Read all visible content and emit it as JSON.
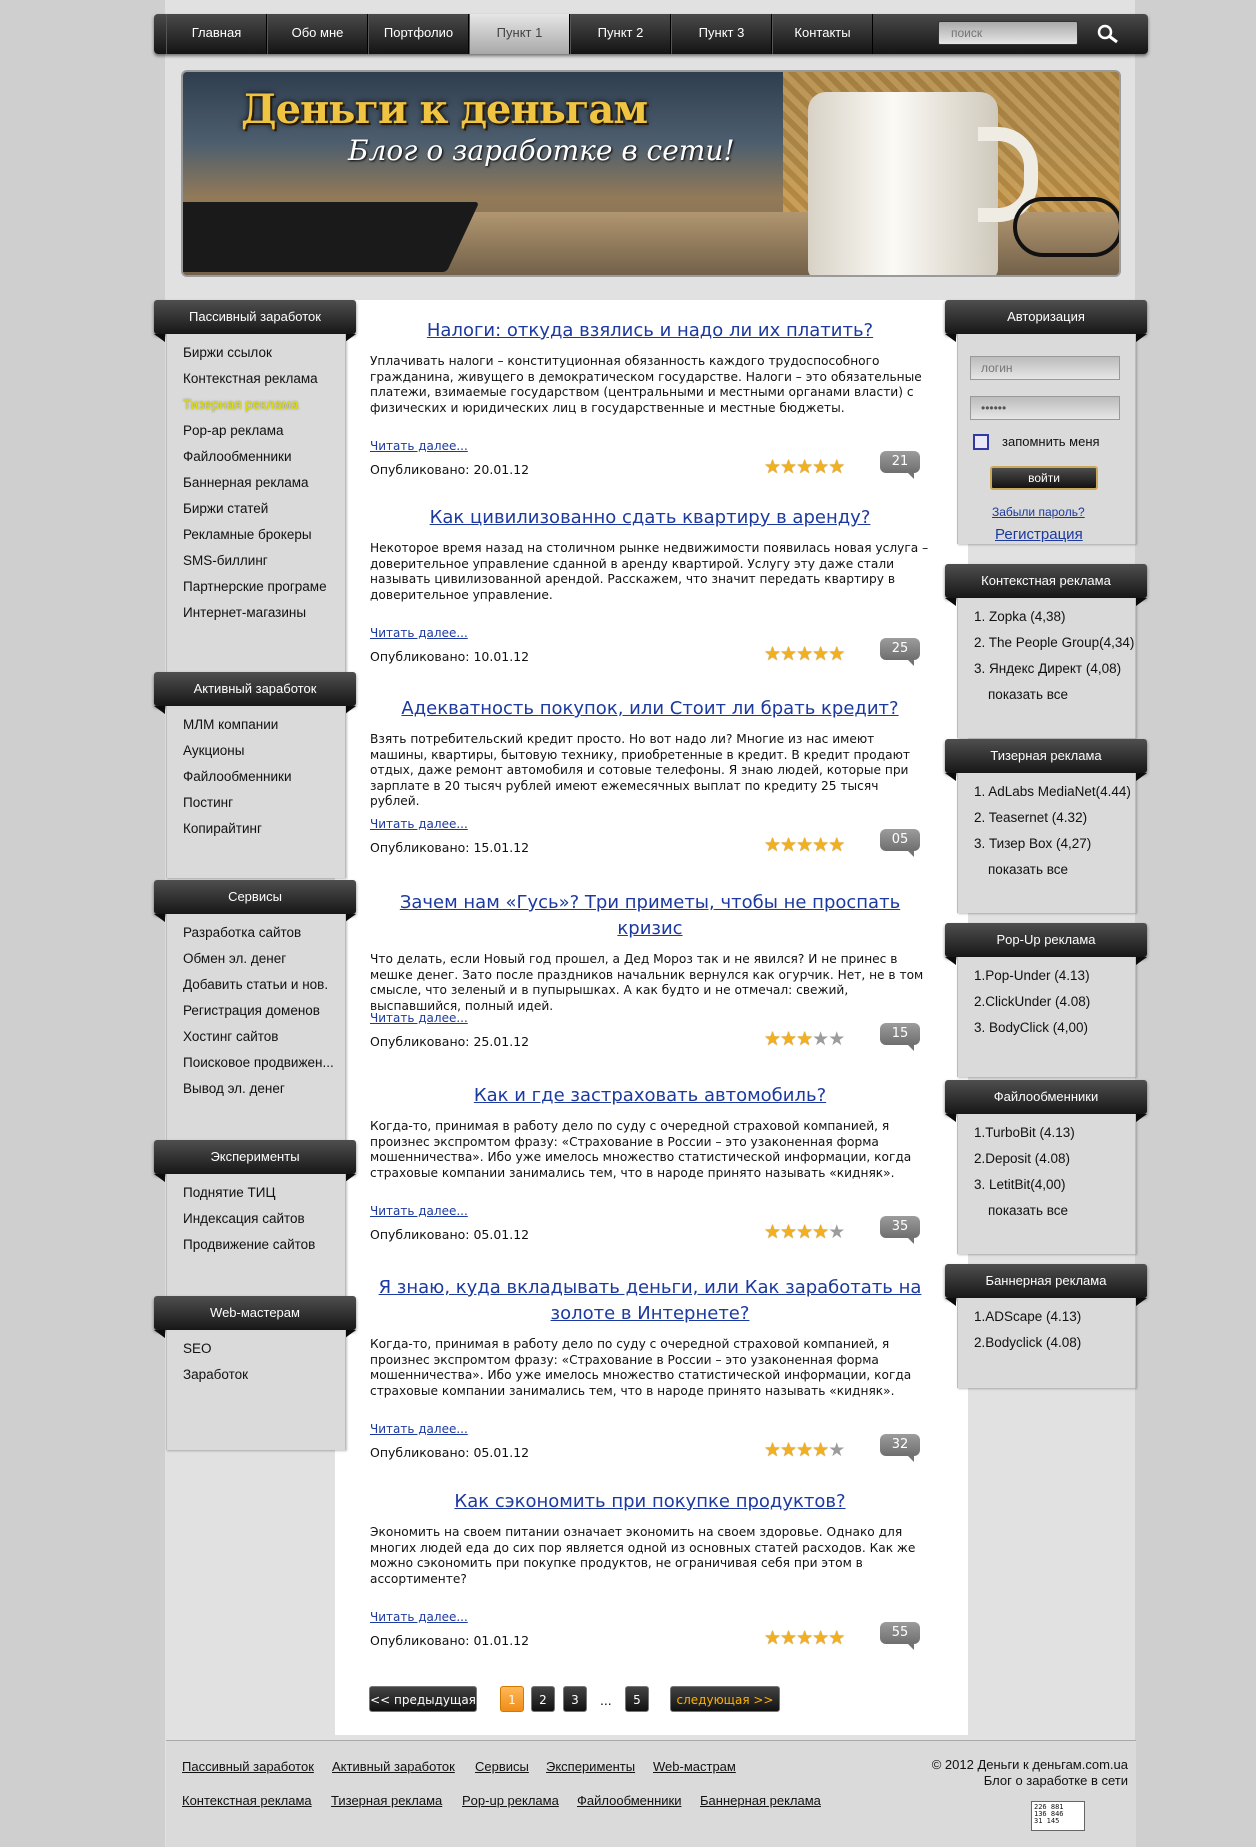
{
  "nav": {
    "items": [
      "Главная",
      "Обо мне",
      "Портфолио",
      "Пункт 1",
      "Пункт 2",
      "Пункт 3",
      "Контакты"
    ],
    "active": 3,
    "search_placeholder": "поиск"
  },
  "banner": {
    "title": "Деньги к деньгам",
    "subtitle": "Блог о заработке в сети!"
  },
  "left": [
    {
      "title": "Пассивный заработок",
      "items": [
        "Биржи ссылок",
        "Контекстная реклама",
        "Тизерная реклама",
        "Pop-ар реклама",
        "Файлообменники",
        "Баннерная реклама",
        "Биржи статей",
        "Рекламные брокеры",
        "SMS-биллинг",
        "Партнерские програме",
        "Интернет-магазины"
      ]
    },
    {
      "title": "Активный заработок",
      "items": [
        "МЛМ компании",
        "Аукционы",
        "Файлообменники",
        "Постинг",
        "Копирайтинг"
      ]
    },
    {
      "title": "Сервисы",
      "items": [
        "Разработка сайтов",
        "Обмен эл. денег",
        "Добавить статьи и нов.",
        "Регистрация доменов",
        "Хостинг сайтов",
        "Поисковое продвижен...",
        "Вывод эл. денег"
      ]
    },
    {
      "title": "Эксперименты",
      "items": [
        "Поднятие ТИЦ",
        "Индексация сайтов",
        "Продвижение сайтов"
      ]
    },
    {
      "title": "Web-мастерам",
      "items": [
        "SEO",
        "Заработок"
      ]
    }
  ],
  "auth": {
    "title": "Авторизация",
    "login_placeholder": "логин",
    "password": "••••••",
    "remember": "запомнить меня",
    "submit": "войти",
    "forgot": "Забыли пароль?",
    "register": "Регистрация"
  },
  "right": [
    {
      "title": "Контекстная реклама",
      "items": [
        "1. Zopka (4,38)",
        "2. The People Group(4,34)",
        "3. Яндекс Директ (4,08)",
        "показать все"
      ]
    },
    {
      "title": "Тизерная реклама",
      "items": [
        "1. AdLabs MediaNet(4.44)",
        "2. Teasernet (4.32)",
        "3. Тизер Box (4,27)",
        "показать все"
      ]
    },
    {
      "title": "Pop-Up реклама",
      "items": [
        "1.Pop-Under (4.13)",
        "2.ClickUnder (4.08)",
        "3. BodyClick (4,00)"
      ]
    },
    {
      "title": "Файлообменники",
      "items": [
        "1.TurboBit (4.13)",
        "2.Deposit (4.08)",
        "3. LetitBit(4,00)",
        "показать все"
      ]
    },
    {
      "title": "Баннерная реклама",
      "items": [
        "1.ADScape (4.13)",
        "2.Bodyclick (4.08)"
      ]
    }
  ],
  "posts": [
    {
      "title": "Налоги: откуда взялись и надо ли их платить?",
      "text": "Уплачивать налоги – конституционная обязанность каждого трудоспособного гражданина, живущего в демократическом государстве. Налоги – это обязательные платежи, взимаемые государством (центральными и местными органами власти) с физических и юридических лиц в государственные и местные бюджеты.",
      "read_more": "Читать далее...",
      "published": "Опубликовано: 20.01.12",
      "rating": 5,
      "comments": "21"
    },
    {
      "title": "Как цивилизованно сдать квартиру в аренду?",
      "text": "Некоторое время назад на столичном рынке недвижимости появилась новая услуга – доверительное управление сданной в аренду квартирой. Услугу эту даже стали называть цивилизованной арендой. Расскажем, что значит передать квартиру в доверительное управление.",
      "read_more": "Читать далее...",
      "published": "Опубликовано: 10.01.12",
      "rating": 5,
      "comments": "25"
    },
    {
      "title": "Адекватность покупок, или Стоит ли брать кредит?",
      "text": "Взять потребительский кредит просто. Но вот надо ли? Многие из нас имеют машины, квартиры, бытовую технику, приобретенные в кредит. В кредит продают отдых, даже ремонт автомобиля и сотовые телефоны. Я знаю людей, которые при зарплате в 20 тысяч рублей имеют ежемесячных выплат по кредиту 25 тысяч рублей.",
      "read_more": "Читать далее...",
      "published": "Опубликовано: 15.01.12",
      "rating": 5,
      "comments": "05"
    },
    {
      "title": "Зачем нам «Гусь»? Три приметы, чтобы не проспать кризис",
      "text": "Что делать, если Новый год прошел, а Дед Мороз так и не явился? И не принес в мешке денег. Зато после праздников начальник вернулся как огурчик. Нет, не в том смысле, что зеленый и в пупырышках. А как будто и не отмечал: свежий, выспавшийся, полный идей.",
      "read_more": "Читать далее...",
      "published": "Опубликовано: 25.01.12",
      "rating": 3,
      "comments": "15"
    },
    {
      "title": "Как и где застраховать автомобиль?",
      "text": "Когда-то, принимая в работу дело по суду с очередной страховой компанией, я произнес экспромтом фразу: «Страхование в России – это узаконенная форма мошенничества». Ибо уже имелось множество статистической информации, когда страховые компании занимались тем, что в народе принято называть «кидняк».",
      "read_more": "Читать далее...",
      "published": "Опубликовано: 05.01.12",
      "rating": 4,
      "comments": "35"
    },
    {
      "title": "Я знаю, куда вкладывать деньги, или Как заработать на золоте в Интернете?",
      "text": "Когда-то, принимая в работу дело по суду с очередной страховой компанией, я произнес экспромтом фразу: «Страхование в России – это узаконенная форма мошенничества». Ибо уже имелось множество статистической информации, когда страховые компании занимались тем, что в народе принято называть «кидняк».",
      "read_more": "Читать далее...",
      "published": "Опубликовано: 05.01.12",
      "rating": 4,
      "comments": "32"
    },
    {
      "title": "Как сэкономить при покупке продуктов?",
      "text": "Экономить на своем питании означает экономить на своем здоровье. Однако для многих людей еда до сих пор является одной из основных статей расходов. Как же можно сэкономить при покупке продуктов, не ограничивая себя при этом в ассортименте?",
      "read_more": "Читать далее...",
      "published": "Опубликовано: 01.01.12",
      "rating": 5,
      "comments": "55"
    }
  ],
  "pager": {
    "prev": "<< предыдущая",
    "pages": [
      "1",
      "2",
      "3",
      "5"
    ],
    "current": "1",
    "ellipsis": "...",
    "next": "следующая >>"
  },
  "footer": {
    "links1": [
      "Пассивный заработок",
      "Активный заработок",
      "Сервисы",
      "Эксперименты",
      "Web-мастрам"
    ],
    "links2": [
      "Контекстная реклама",
      "Тизерная реклама",
      "Pop-up реклама",
      "Файлообменники",
      "Баннерная реклама"
    ],
    "copyright": "© 2012 Деньги к деньгам.com.ua",
    "tagline": "Блог о заработке в сети",
    "counter": [
      "226 881",
      "136 846",
      "31 145"
    ]
  }
}
